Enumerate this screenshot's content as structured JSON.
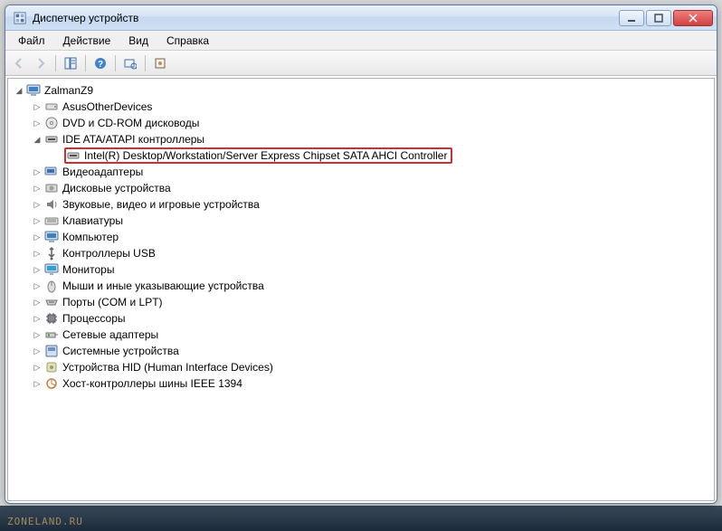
{
  "window": {
    "title": "Диспетчер устройств"
  },
  "menu": {
    "file": "Файл",
    "action": "Действие",
    "view": "Вид",
    "help": "Справка"
  },
  "tree": {
    "root": "ZalmanZ9",
    "nodes": [
      "AsusOtherDevices",
      "DVD и CD-ROM дисководы",
      "IDE ATA/ATAPI контроллеры",
      "Видеоадаптеры",
      "Дисковые устройства",
      "Звуковые, видео и игровые устройства",
      "Клавиатуры",
      "Компьютер",
      "Контроллеры USB",
      "Мониторы",
      "Мыши и иные указывающие устройства",
      "Порты (COM и LPT)",
      "Процессоры",
      "Сетевые адаптеры",
      "Системные устройства",
      "Устройства HID (Human Interface Devices)",
      "Хост-контроллеры шины IEEE 1394"
    ],
    "ide_child": "Intel(R) Desktop/Workstation/Server Express Chipset SATA AHCI Controller"
  },
  "watermark": "ZONELAND.RU"
}
